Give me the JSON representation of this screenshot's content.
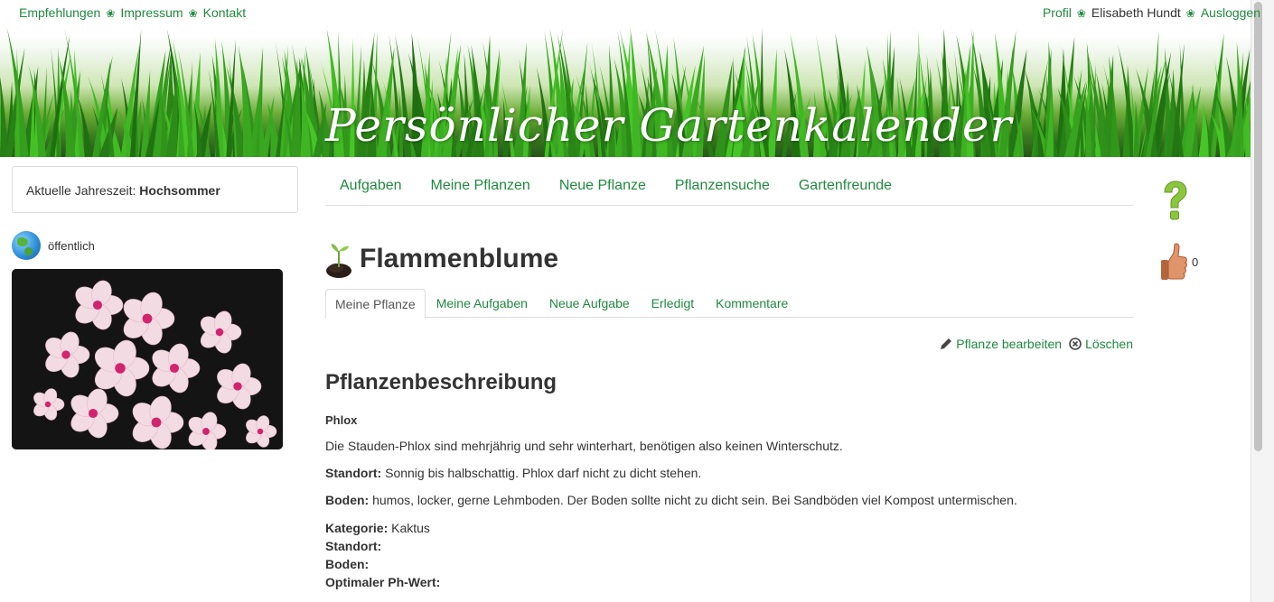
{
  "top_nav": {
    "left_links": [
      "Empfehlungen",
      "Impressum",
      "Kontakt"
    ],
    "profile_link": "Profil",
    "user_name": "Elisabeth Hundt",
    "logout_link": "Ausloggen",
    "separator": "❀"
  },
  "header": {
    "title": "Persönlicher Gartenkalender"
  },
  "sidebar": {
    "season_label": "Aktuelle Jahreszeit:",
    "season_value": "Hochsommer",
    "visibility_label": "öffentlich"
  },
  "main_nav": {
    "items": [
      "Aufgaben",
      "Meine Pflanzen",
      "Neue Pflanze",
      "Pflanzensuche",
      "Gartenfreunde"
    ]
  },
  "plant": {
    "title": "Flammenblume",
    "tabs": [
      "Meine Pflanze",
      "Meine Aufgaben",
      "Neue Aufgabe",
      "Erledigt",
      "Kommentare"
    ],
    "active_tab": "Meine Pflanze",
    "edit_label": "Pflanze bearbeiten",
    "delete_label": "Löschen"
  },
  "right_panel": {
    "like_count": "0"
  },
  "description": {
    "heading": "Pflanzenbeschreibung",
    "botanical_name": "Phlox",
    "intro": "Die Stauden-Phlox sind mehrjährig und sehr winterhart, benötigen also keinen Winterschutz.",
    "standort_label": "Standort:",
    "standort_text": " Sonnig bis halbschattig. Phlox darf nicht zu dicht stehen.",
    "boden_label": "Boden:",
    "boden_text": " humos, locker, gerne Lehmboden. Der Boden sollte nicht zu dicht sein. Bei Sandböden viel Kompost untermischen.",
    "kategorie_label": "Kategorie:",
    "kategorie_value": " Kaktus",
    "standort2_label": "Standort:",
    "boden2_label": "Boden:",
    "ph_label": "Optimaler Ph-Wert:"
  },
  "colors": {
    "link_green": "#1f8a3e",
    "text": "#333333",
    "border": "#dddddd"
  }
}
